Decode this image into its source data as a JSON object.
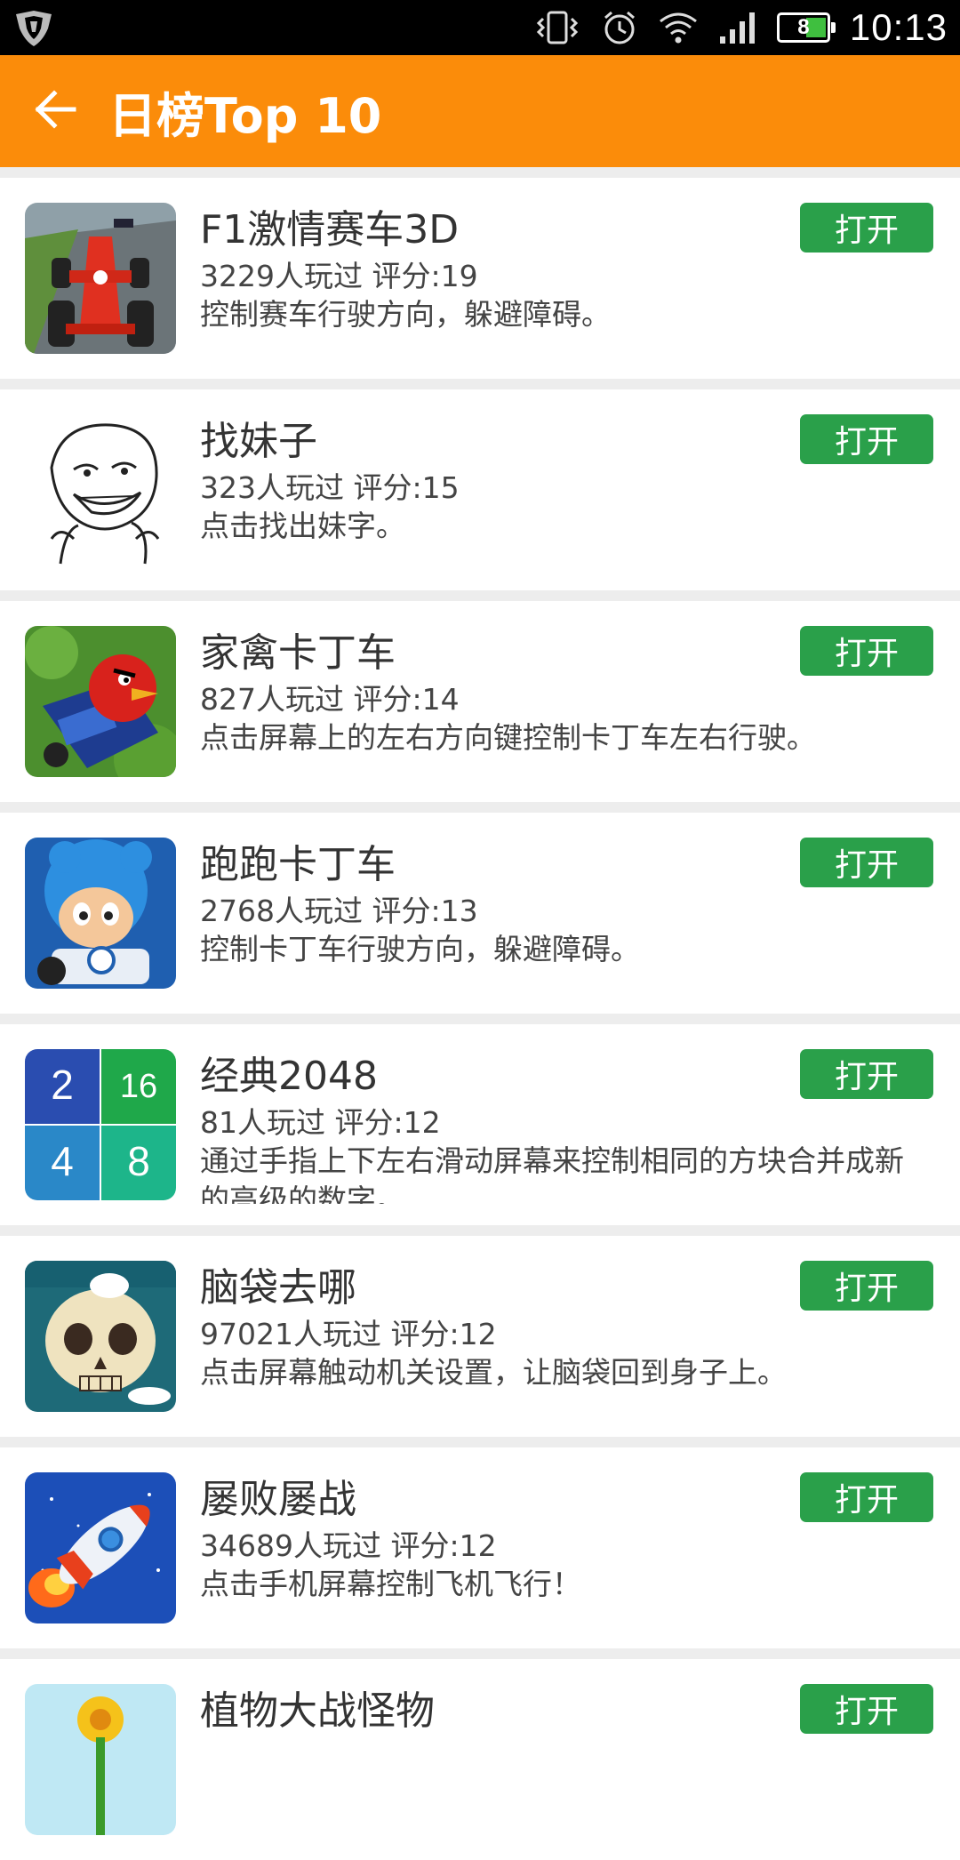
{
  "status_bar": {
    "time": "10:13",
    "battery_level": "8",
    "icons": [
      "shield-icon",
      "vibrate-icon",
      "alarm-icon",
      "wifi-icon",
      "signal-icon",
      "battery-icon"
    ]
  },
  "app_bar": {
    "title": "日榜Top 10",
    "back_icon": "arrow-left-icon",
    "color": "#fb8c0a"
  },
  "accent": {
    "open_button": "#2aa04a"
  },
  "games": [
    {
      "title": "F1激情赛车3D",
      "meta": "3229人玩过 评分:19",
      "desc": "控制赛车行驶方向，躲避障碍。",
      "button": "打开",
      "icon": "race-car-icon"
    },
    {
      "title": "找妹子",
      "meta": "323人玩过 评分:15",
      "desc": "点击找出妹字。",
      "button": "打开",
      "icon": "meme-face-icon"
    },
    {
      "title": "家禽卡丁车",
      "meta": "827人玩过 评分:14",
      "desc": "点击屏幕上的左右方向键控制卡丁车左右行驶。",
      "button": "打开",
      "icon": "bird-kart-icon"
    },
    {
      "title": "跑跑卡丁车",
      "meta": "2768人玩过 评分:13",
      "desc": "控制卡丁车行驶方向，躲避障碍。",
      "button": "打开",
      "icon": "kart-rider-icon"
    },
    {
      "title": "经典2048",
      "meta": "81人玩过 评分:12",
      "desc": "通过手指上下左右滑动屏幕来控制相同的方块合并成新的高级的数字。",
      "button": "打开",
      "icon": "tiles-2048-icon",
      "tiles": [
        "2",
        "16",
        "4",
        "8"
      ]
    },
    {
      "title": "脑袋去哪",
      "meta": "97021人玩过 评分:12",
      "desc": "点击屏幕触动机关设置，让脑袋回到身子上。",
      "button": "打开",
      "icon": "skull-icon"
    },
    {
      "title": "屡败屡战",
      "meta": "34689人玩过 评分:12",
      "desc": "点击手机屏幕控制飞机飞行！",
      "button": "打开",
      "icon": "rocket-icon"
    },
    {
      "title": "植物大战怪物",
      "meta": "",
      "desc": "",
      "button": "打开",
      "icon": "plant-icon"
    }
  ]
}
